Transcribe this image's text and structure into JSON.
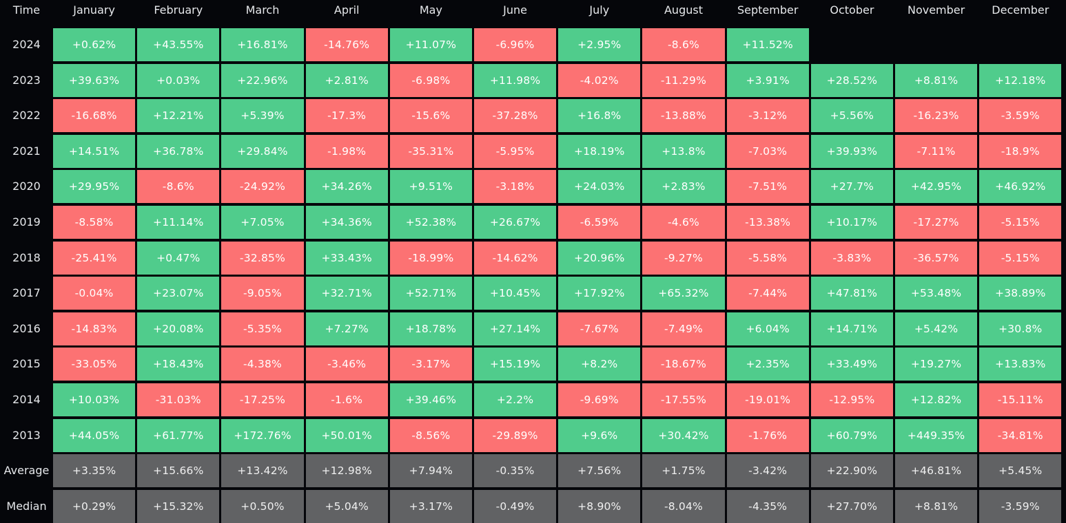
{
  "chart_data": {
    "type": "heatmap",
    "title": "",
    "corner_label": "Time",
    "columns": [
      "January",
      "February",
      "March",
      "April",
      "May",
      "June",
      "July",
      "August",
      "September",
      "October",
      "November",
      "December"
    ],
    "colors": {
      "positive": "#50cc8c",
      "negative": "#fc7273",
      "summary": "#616264",
      "background": "#05060a"
    },
    "rows": [
      {
        "label": "2024",
        "values": [
          "+0.62%",
          "+43.55%",
          "+16.81%",
          "-14.76%",
          "+11.07%",
          "-6.96%",
          "+2.95%",
          "-8.6%",
          "+11.52%",
          null,
          null,
          null
        ]
      },
      {
        "label": "2023",
        "values": [
          "+39.63%",
          "+0.03%",
          "+22.96%",
          "+2.81%",
          "-6.98%",
          "+11.98%",
          "-4.02%",
          "-11.29%",
          "+3.91%",
          "+28.52%",
          "+8.81%",
          "+12.18%"
        ]
      },
      {
        "label": "2022",
        "values": [
          "-16.68%",
          "+12.21%",
          "+5.39%",
          "-17.3%",
          "-15.6%",
          "-37.28%",
          "+16.8%",
          "-13.88%",
          "-3.12%",
          "+5.56%",
          "-16.23%",
          "-3.59%"
        ]
      },
      {
        "label": "2021",
        "values": [
          "+14.51%",
          "+36.78%",
          "+29.84%",
          "-1.98%",
          "-35.31%",
          "-5.95%",
          "+18.19%",
          "+13.8%",
          "-7.03%",
          "+39.93%",
          "-7.11%",
          "-18.9%"
        ]
      },
      {
        "label": "2020",
        "values": [
          "+29.95%",
          "-8.6%",
          "-24.92%",
          "+34.26%",
          "+9.51%",
          "-3.18%",
          "+24.03%",
          "+2.83%",
          "-7.51%",
          "+27.7%",
          "+42.95%",
          "+46.92%"
        ]
      },
      {
        "label": "2019",
        "values": [
          "-8.58%",
          "+11.14%",
          "+7.05%",
          "+34.36%",
          "+52.38%",
          "+26.67%",
          "-6.59%",
          "-4.6%",
          "-13.38%",
          "+10.17%",
          "-17.27%",
          "-5.15%"
        ]
      },
      {
        "label": "2018",
        "values": [
          "-25.41%",
          "+0.47%",
          "-32.85%",
          "+33.43%",
          "-18.99%",
          "-14.62%",
          "+20.96%",
          "-9.27%",
          "-5.58%",
          "-3.83%",
          "-36.57%",
          "-5.15%"
        ]
      },
      {
        "label": "2017",
        "values": [
          "-0.04%",
          "+23.07%",
          "-9.05%",
          "+32.71%",
          "+52.71%",
          "+10.45%",
          "+17.92%",
          "+65.32%",
          "-7.44%",
          "+47.81%",
          "+53.48%",
          "+38.89%"
        ]
      },
      {
        "label": "2016",
        "values": [
          "-14.83%",
          "+20.08%",
          "-5.35%",
          "+7.27%",
          "+18.78%",
          "+27.14%",
          "-7.67%",
          "-7.49%",
          "+6.04%",
          "+14.71%",
          "+5.42%",
          "+30.8%"
        ]
      },
      {
        "label": "2015",
        "values": [
          "-33.05%",
          "+18.43%",
          "-4.38%",
          "-3.46%",
          "-3.17%",
          "+15.19%",
          "+8.2%",
          "-18.67%",
          "+2.35%",
          "+33.49%",
          "+19.27%",
          "+13.83%"
        ]
      },
      {
        "label": "2014",
        "values": [
          "+10.03%",
          "-31.03%",
          "-17.25%",
          "-1.6%",
          "+39.46%",
          "+2.2%",
          "-9.69%",
          "-17.55%",
          "-19.01%",
          "-12.95%",
          "+12.82%",
          "-15.11%"
        ]
      },
      {
        "label": "2013",
        "values": [
          "+44.05%",
          "+61.77%",
          "+172.76%",
          "+50.01%",
          "-8.56%",
          "-29.89%",
          "+9.6%",
          "+30.42%",
          "-1.76%",
          "+60.79%",
          "+449.35%",
          "-34.81%"
        ]
      }
    ],
    "summary_rows": [
      {
        "label": "Average",
        "values": [
          "+3.35%",
          "+15.66%",
          "+13.42%",
          "+12.98%",
          "+7.94%",
          "-0.35%",
          "+7.56%",
          "+1.75%",
          "-3.42%",
          "+22.90%",
          "+46.81%",
          "+5.45%"
        ]
      },
      {
        "label": "Median",
        "values": [
          "+0.29%",
          "+15.32%",
          "+0.50%",
          "+5.04%",
          "+3.17%",
          "-0.49%",
          "+8.90%",
          "-8.04%",
          "-4.35%",
          "+27.70%",
          "+8.81%",
          "-3.59%"
        ]
      }
    ]
  }
}
